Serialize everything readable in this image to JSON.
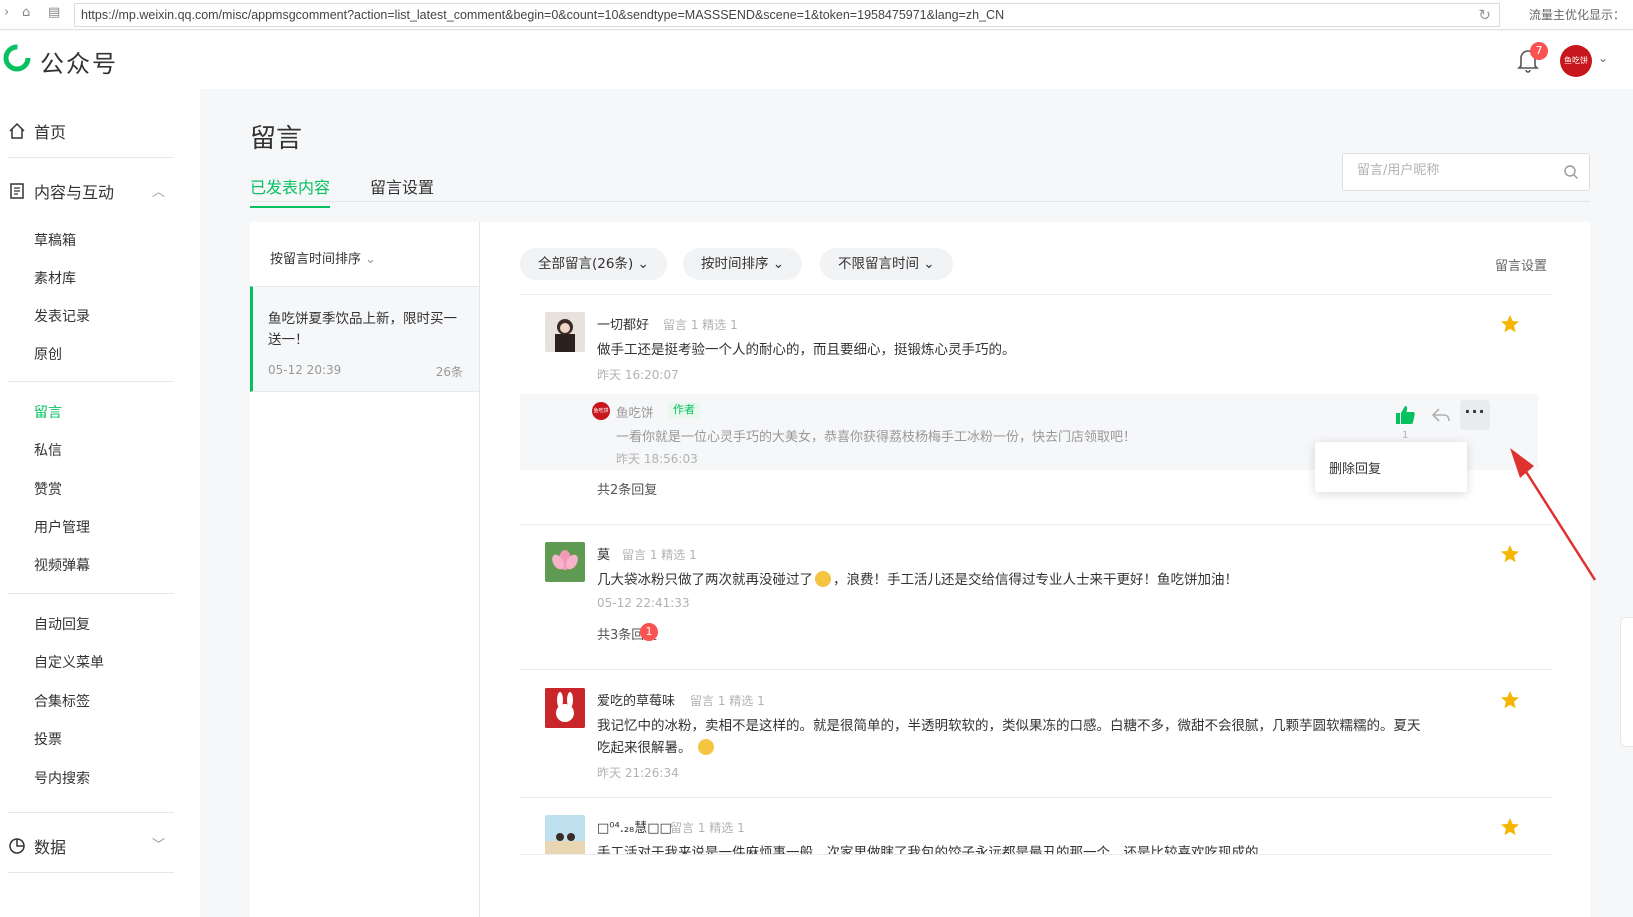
{
  "browser": {
    "url": "https://mp.weixin.qq.com/misc/appmsgcomment?action=list_latest_comment&begin=0&count=10&sendtype=MASSSEND&scene=1&token=1958475971&lang=zh_CN",
    "right_text": "流量主优化显示："
  },
  "header": {
    "brand": "公众号",
    "notification_count": "7",
    "avatar_text": "鱼吃饼"
  },
  "sidebar": {
    "home": "首页",
    "content_section": "内容与互动",
    "items_content": [
      "草稿箱",
      "素材库",
      "发表记录",
      "原创"
    ],
    "items_interact": [
      "留言",
      "私信",
      "赞赏",
      "用户管理",
      "视频弹幕"
    ],
    "items_tools": [
      "自动回复",
      "自定义菜单",
      "合集标签",
      "投票",
      "号内搜索"
    ],
    "data_section": "数据"
  },
  "page": {
    "title": "留言",
    "tabs": [
      "已发表内容",
      "留言设置"
    ],
    "search_placeholder": "留言/用户昵称"
  },
  "article_panel": {
    "sort_label": "按留言时间排序",
    "article": {
      "title": "鱼吃饼夏季饮品上新，限时买一送一！",
      "date": "05-12 20:39",
      "count": "26条"
    }
  },
  "filters": {
    "all": "全部留言(26条)",
    "sort": "按时间排序",
    "time": "不限留言时间",
    "settings": "留言设置"
  },
  "comments": [
    {
      "name": "一切都好",
      "meta": "留言 1  精选 1",
      "text": "做手工还是挺考验一个人的耐心的，而且要细心，挺锻炼心灵手巧的。",
      "time": "昨天 16:20:07",
      "replies": "共2条回复"
    },
    {
      "name": "莫",
      "meta": "留言 1  精选 1",
      "text_before": "几大袋冰粉只做了两次就再没碰过了",
      "text_after": "，浪费！手工活儿还是交给信得过专业人士来干更好！鱼吃饼加油！",
      "time": "05-12 22:41:33",
      "replies": "共3条回复",
      "badge": "1"
    },
    {
      "name": "爱吃的草莓味",
      "meta": "留言 1  精选 1",
      "text": "我记忆中的冰粉，卖相不是这样的。就是很简单的，半透明软软的，类似果冻的口感。白糖不多，微甜不会很腻，几颗芋圆软糯糯的。夏天吃起来很解暑。",
      "time": "昨天 21:26:34"
    },
    {
      "name": "□⁰⁴.₂₈慧□□",
      "meta": "留言 1  精选 1",
      "text": "手工活对于我来说是一件麻烦事一般，次家里做瞎了我包的饺子永远都是最丑的那一个，还是比较喜欢吃现成的"
    }
  ],
  "author_reply": {
    "name": "鱼吃饼",
    "tag": "作者",
    "text": "一看你就是一位心灵手巧的大美女，恭喜你获得荔枝杨梅手工冰粉一份，快去门店领取吧！",
    "time": "昨天 18:56:03",
    "likes": "1"
  },
  "popup": {
    "delete_reply": "删除回复"
  },
  "colors": {
    "accent": "#07c160",
    "badge": "#fa5151",
    "star": "#f7b500",
    "arrow": "#e03131"
  }
}
